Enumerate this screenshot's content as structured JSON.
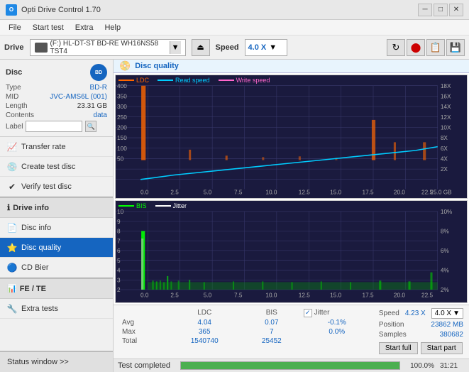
{
  "titlebar": {
    "title": "Opti Drive Control 1.70",
    "icon_text": "O",
    "btn_minimize": "─",
    "btn_maximize": "□",
    "btn_close": "✕"
  },
  "menubar": {
    "items": [
      "File",
      "Start test",
      "Extra",
      "Help"
    ]
  },
  "drivebar": {
    "label": "Drive",
    "drive_text": "(F:) HL-DT-ST BD-RE  WH16NS58 TST4",
    "speed_label": "Speed",
    "speed_value": "4.0 X"
  },
  "disc": {
    "title": "Disc",
    "type_label": "Type",
    "type_value": "BD-R",
    "mid_label": "MID",
    "mid_value": "JVC-AMS6L (001)",
    "length_label": "Length",
    "length_value": "23.31 GB",
    "contents_label": "Contents",
    "contents_value": "data",
    "label_label": "Label",
    "label_value": ""
  },
  "nav_items": [
    {
      "id": "transfer-rate",
      "label": "Transfer rate",
      "icon": "📈"
    },
    {
      "id": "create-test-disc",
      "label": "Create test disc",
      "icon": "💿"
    },
    {
      "id": "verify-test-disc",
      "label": "Verify test disc",
      "icon": "✔"
    },
    {
      "id": "drive-info",
      "label": "Drive info",
      "icon": "ℹ"
    },
    {
      "id": "disc-info",
      "label": "Disc info",
      "icon": "📄"
    },
    {
      "id": "disc-quality",
      "label": "Disc quality",
      "icon": "⭐",
      "active": true
    },
    {
      "id": "cd-bier",
      "label": "CD Bier",
      "icon": "🔵"
    },
    {
      "id": "fe-te",
      "label": "FE / TE",
      "icon": "📊"
    },
    {
      "id": "extra-tests",
      "label": "Extra tests",
      "icon": "🔧"
    }
  ],
  "chart": {
    "title": "Disc quality",
    "legend_top": [
      {
        "label": "LDC",
        "color": "#ff6600"
      },
      {
        "label": "Read speed",
        "color": "#00ccff"
      },
      {
        "label": "Write speed",
        "color": "#ff66cc"
      }
    ],
    "legend_bottom": [
      {
        "label": "BIS",
        "color": "#00ff00"
      },
      {
        "label": "Jitter",
        "color": "#ffffff"
      }
    ],
    "x_max": "25.0",
    "x_unit": "GB",
    "y_right_top_max": "18X",
    "y_right_bottom_max": "10%"
  },
  "stats": {
    "col_ldc": "LDC",
    "col_bis": "BIS",
    "col_jitter": "Jitter",
    "row_avg": "Avg",
    "row_max": "Max",
    "row_total": "Total",
    "avg_ldc": "4.04",
    "avg_bis": "0.07",
    "avg_jitter": "-0.1%",
    "max_ldc": "365",
    "max_bis": "7",
    "max_jitter": "0.0%",
    "total_ldc": "1540740",
    "total_bis": "25452",
    "total_jitter": "",
    "jitter_label": "Jitter",
    "jitter_checked": true,
    "speed_label": "Speed",
    "speed_value": "4.23 X",
    "speed_set": "4.0 X",
    "position_label": "Position",
    "position_value": "23862 MB",
    "samples_label": "Samples",
    "samples_value": "380682",
    "btn_start_full": "Start full",
    "btn_start_part": "Start part"
  },
  "statusbar": {
    "status_text": "Test completed",
    "progress": 100,
    "progress_label": "100.0%",
    "time": "31:21",
    "status_window_label": "Status window >>"
  }
}
